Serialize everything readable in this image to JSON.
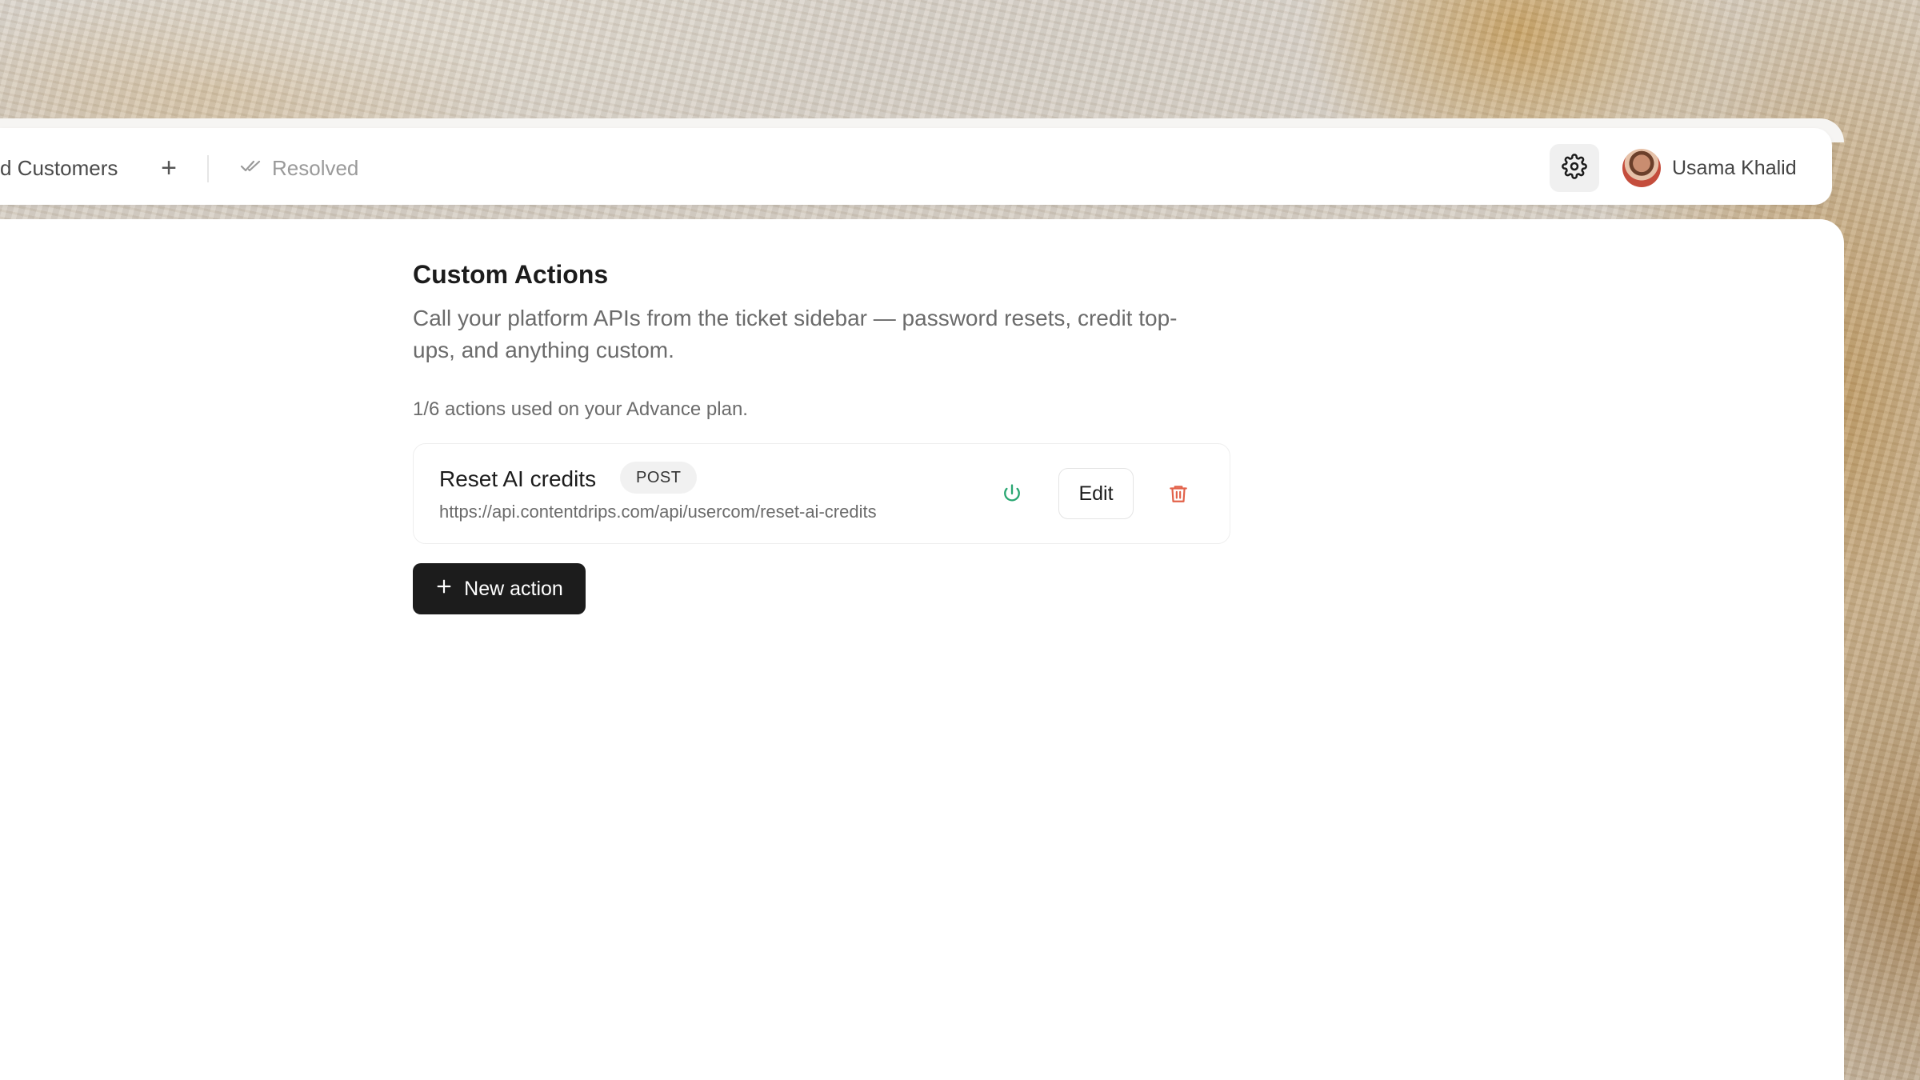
{
  "header": {
    "tabs": [
      {
        "label": "d Customers"
      },
      {
        "label": "Resolved"
      }
    ],
    "add_tab_symbol": "+",
    "user": {
      "name": "Usama Khalid"
    }
  },
  "main": {
    "title": "Custom Actions",
    "description": "Call your platform APIs from the ticket sidebar — password resets, credit top-ups, and anything custom.",
    "usage": "1/6 actions used on your Advance plan.",
    "actions": [
      {
        "name": "Reset AI credits",
        "method": "POST",
        "url": "https://api.contentdrips.com/api/usercom/reset-ai-credits",
        "edit_label": "Edit"
      }
    ],
    "new_action_label": "New action"
  },
  "colors": {
    "primary_button": "#1c1c1c",
    "power_enabled": "#2aa772",
    "delete": "#e2624a"
  },
  "icons": [
    "check-double-icon",
    "gear-icon",
    "power-icon",
    "trash-icon",
    "plus-icon"
  ]
}
